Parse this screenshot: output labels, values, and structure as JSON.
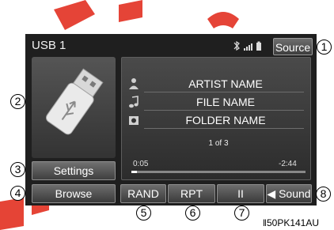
{
  "header": {
    "title": "USB 1",
    "source_label": "Source"
  },
  "controls": {
    "settings_label": "Settings",
    "browse_label": "Browse"
  },
  "track": {
    "artist": "ARTIST NAME",
    "file": "FILE NAME",
    "folder": "FOLDER NAME",
    "count": "1 of 3",
    "elapsed": "0:05",
    "remaining": "-2:44",
    "progress": 0.03
  },
  "bottom": {
    "rand_label": "RAND",
    "rpt_label": "RPT",
    "pause_label": "II",
    "sound_label": "Sound"
  },
  "callouts": {
    "c1": "1",
    "c2": "2",
    "c3": "3",
    "c4": "4",
    "c5": "5",
    "c6": "6",
    "c7": "7",
    "c8": "8"
  },
  "figure_code": "50PK141AU",
  "colors": {
    "screen_bg": "#1f1f1f",
    "watermark": "#e43a2c"
  }
}
